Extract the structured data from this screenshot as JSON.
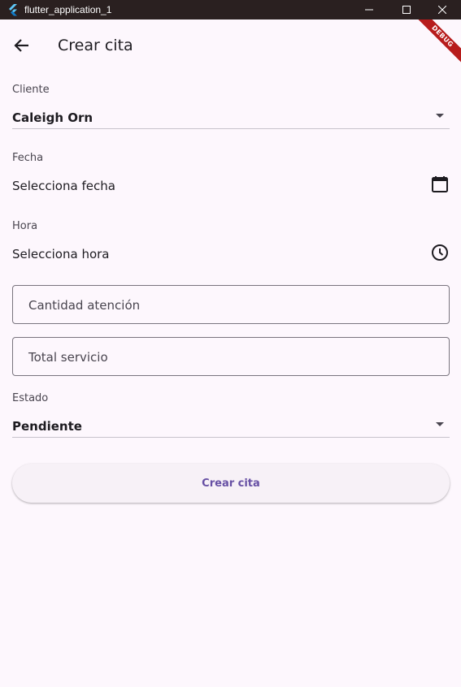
{
  "window": {
    "title": "flutter_application_1"
  },
  "debug_banner": "DEBUG",
  "appbar": {
    "title": "Crear cita"
  },
  "form": {
    "cliente": {
      "label": "Cliente",
      "value": "Caleigh Orn"
    },
    "fecha": {
      "label": "Fecha",
      "value": "Selecciona fecha",
      "icon": "calendar-icon"
    },
    "hora": {
      "label": "Hora",
      "value": "Selecciona hora",
      "icon": "clock-icon"
    },
    "cantidad": {
      "placeholder": "Cantidad atención"
    },
    "total": {
      "placeholder": "Total servicio"
    },
    "estado": {
      "label": "Estado",
      "value": "Pendiente"
    },
    "submit_label": "Crear cita"
  },
  "colors": {
    "background": "#fdf7fd",
    "titlebar": "#2a2020",
    "accent": "#6750a4",
    "debug": "#b71c1c"
  }
}
